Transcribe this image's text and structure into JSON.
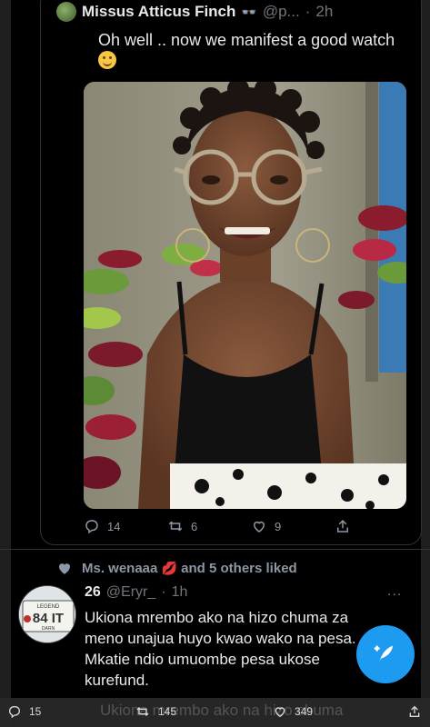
{
  "quoted_tweet": {
    "display_name": "Missus Atticus Finch",
    "handle": "@p...",
    "separator": "·",
    "time": "2h",
    "text": "Oh well .. now we manifest a good watch",
    "emoji": "smiling-face",
    "stats": {
      "replies": "14",
      "retweets": "6",
      "likes": "9"
    }
  },
  "liked_by": {
    "text_name": "Ms. wenaaa",
    "text_rest": "and 5 others liked"
  },
  "reply": {
    "display_name": "26",
    "handle": "@Eryr_",
    "separator": "·",
    "time": "1h",
    "text": "Ukiona mrembo ako na hizo chuma za meno unajua huyo kwao wako na pesa. Mkatie ndio umuombe pesa ukose kurefund.",
    "more": "..."
  },
  "bottom_bar": {
    "ghost_text": "Ukiona mrembo ako na hizo chuma",
    "replies": "15",
    "retweets": "145",
    "likes": "349"
  },
  "colors": {
    "accent": "#1d9bf0",
    "background": "#000000",
    "secondary_text": "#8b98a5"
  }
}
